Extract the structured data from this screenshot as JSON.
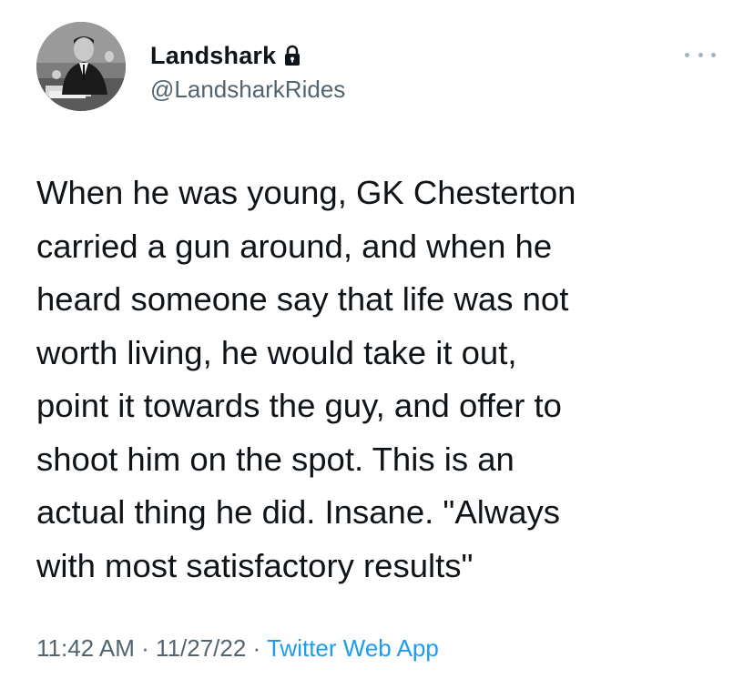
{
  "tweet": {
    "author": {
      "display_name": "Landshark",
      "handle": "@LandsharkRides",
      "protected_icon": "lock-icon",
      "avatar": "black-and-white photo of man at desk"
    },
    "more_icon": "more-horizontal-icon",
    "text": "When he was young, GK Chesterton\ncarried a gun around, and when he\nheard someone say that life was not\nworth living, he would take it out,\npoint it towards the guy, and offer to\nshoot him on the spot. This is an\nactual thing he did. Insane. \"Always\nwith most satisfactory results\"",
    "time": "11:42 AM",
    "separator": " · ",
    "date": "11/27/22",
    "source": "Twitter Web App",
    "colors": {
      "text": "#0f1419",
      "secondary": "#536471",
      "link": "#1d9bf0"
    }
  }
}
